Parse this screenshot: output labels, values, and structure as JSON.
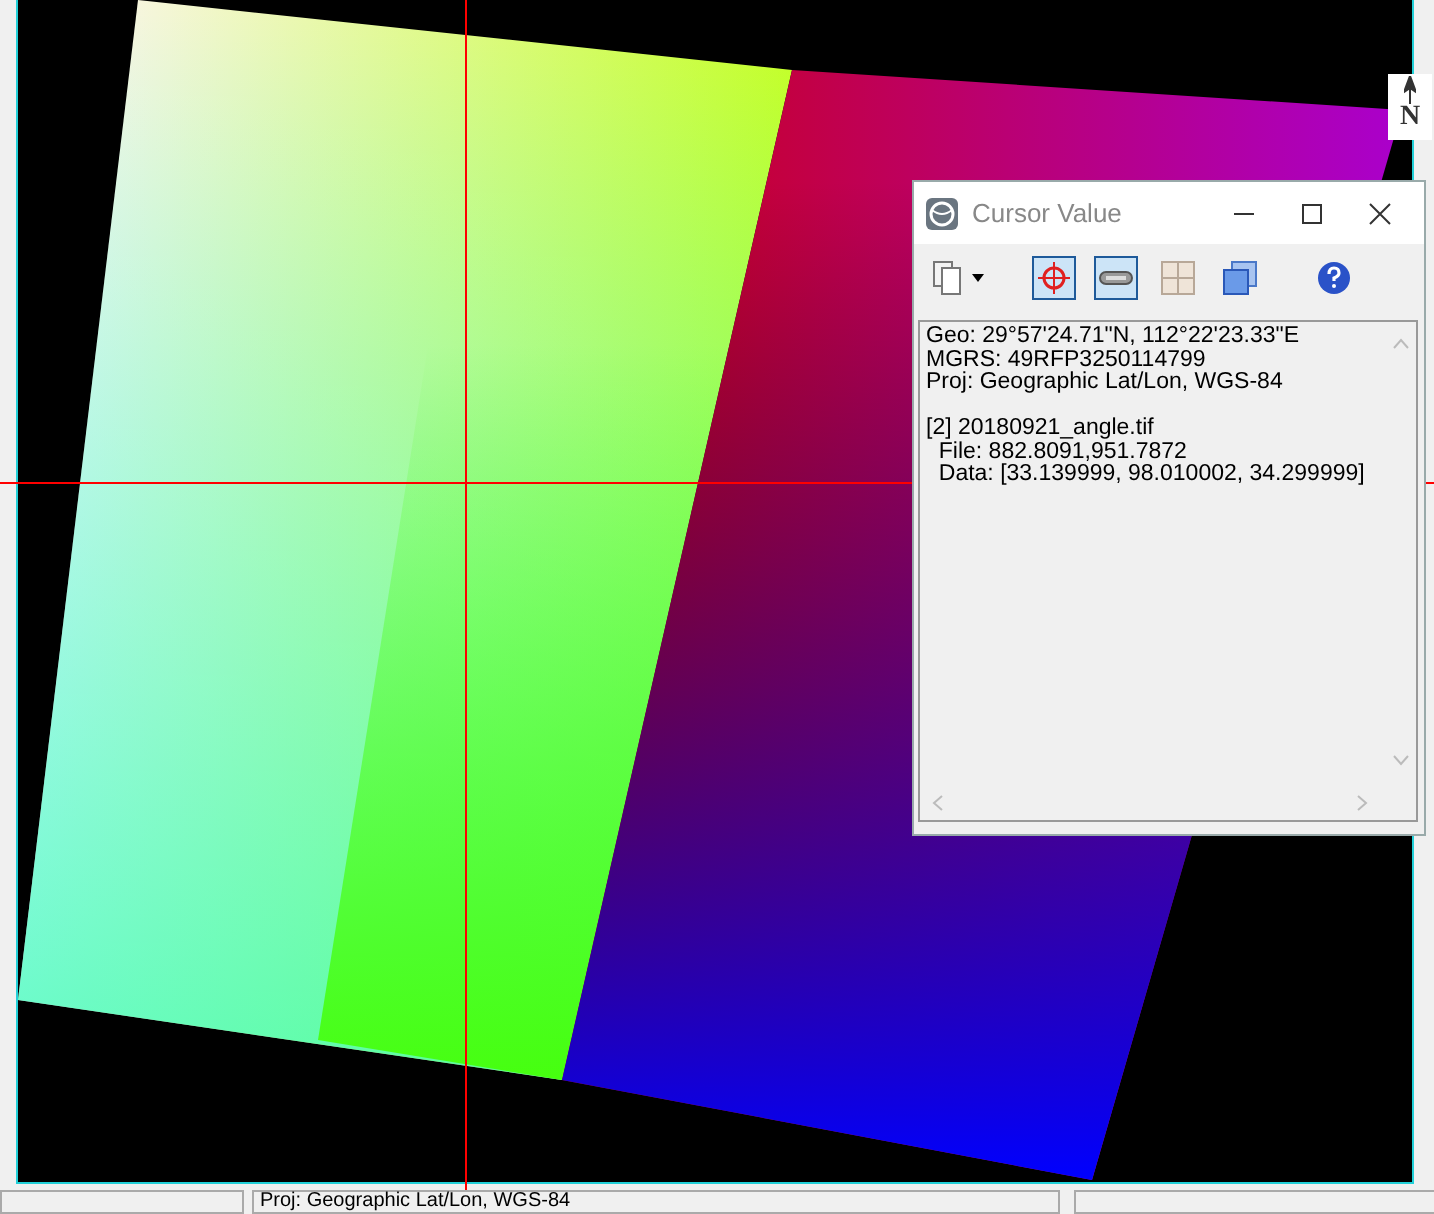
{
  "viewer": {
    "north_arrow": {
      "label": "N"
    }
  },
  "cursor_window": {
    "title": "Cursor Value",
    "toolbar": [
      {
        "kind": "copy",
        "selected": false
      },
      {
        "kind": "crosshair",
        "selected": true
      },
      {
        "kind": "link",
        "selected": true
      },
      {
        "kind": "grid",
        "selected": false
      },
      {
        "kind": "windows",
        "selected": false
      },
      {
        "kind": "help",
        "selected": false
      }
    ],
    "blocks": [
      [
        "Geo: 29°57'24.71\"N, 112°22'23.33\"E",
        "MGRS: 49RFP3250114799",
        "Proj: Geographic Lat/Lon, WGS-84"
      ],
      [
        "[2] 20180921_angle.tif",
        "  File: 882.8091,951.7872",
        "  Data: [33.139999, 98.010002, 34.299999]"
      ]
    ]
  },
  "status_bar": {
    "projection": "Proj: Geographic Lat/Lon, WGS-84"
  }
}
